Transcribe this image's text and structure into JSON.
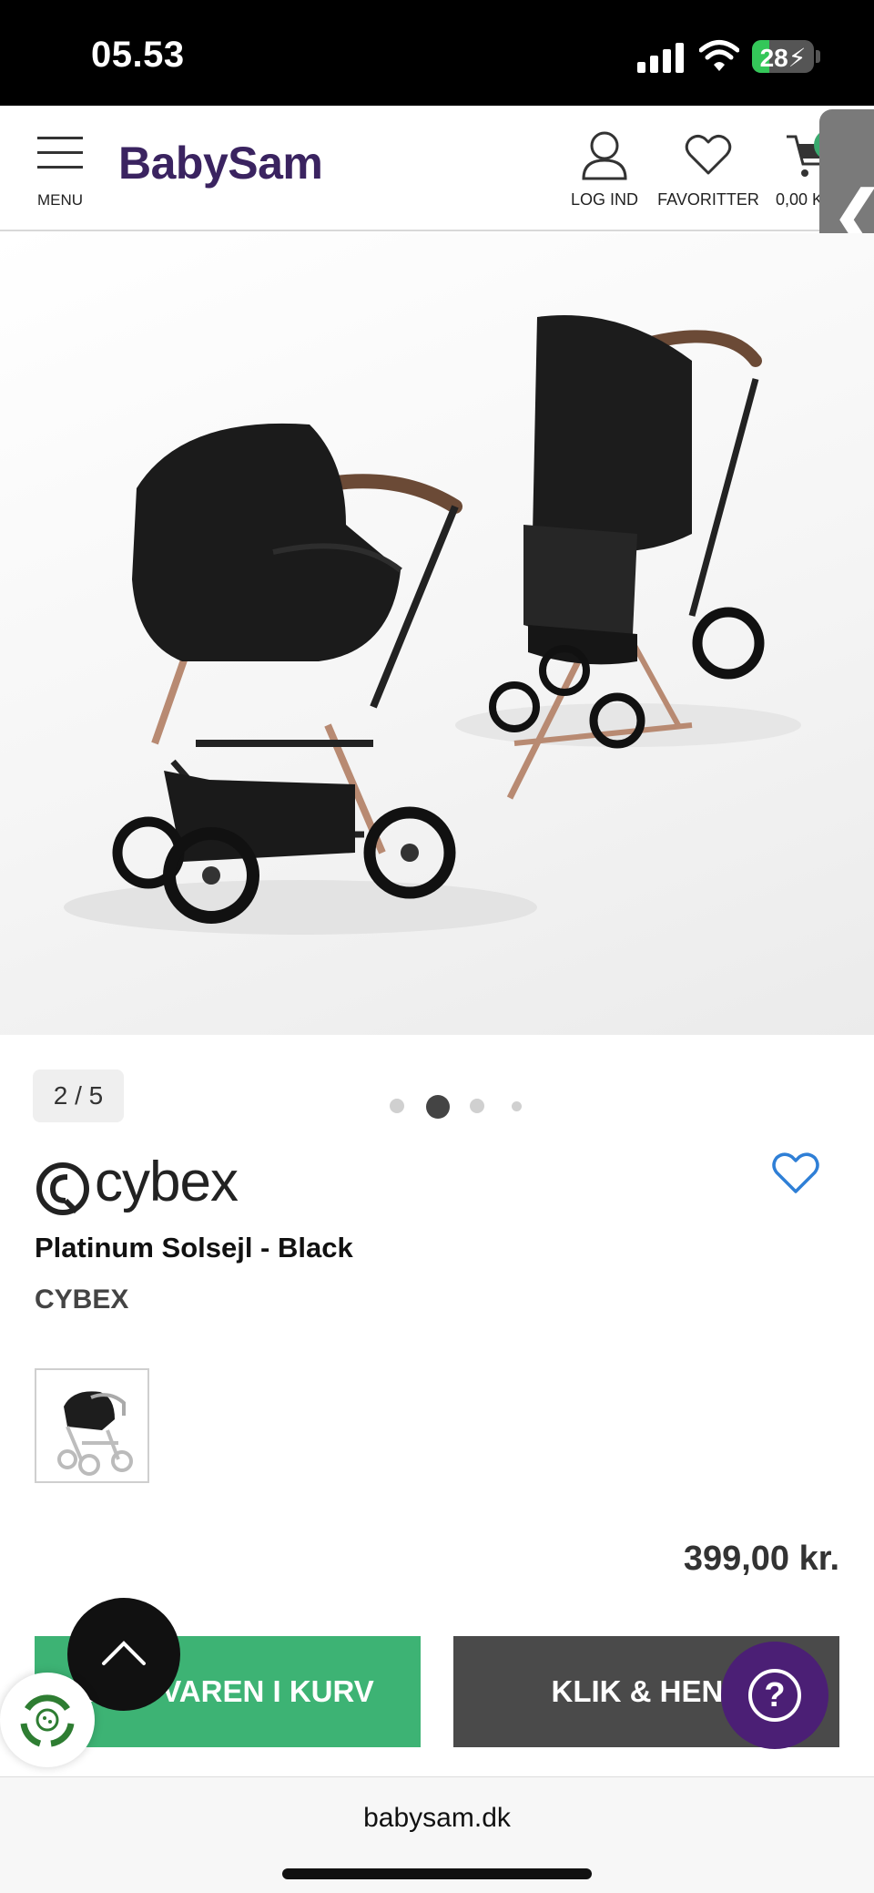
{
  "status_bar": {
    "time": "05.53",
    "battery": "28",
    "battery_level": 0.28,
    "icons": [
      "cellular-signal-icon",
      "wifi-icon",
      "battery-charging-icon"
    ]
  },
  "header": {
    "menu_label": "MENU",
    "logo": "BabySam",
    "login_label": "LOG IND",
    "favorites_label": "FAVORITTER",
    "cart_label": "0,00 K",
    "colors": {
      "logo": "#3a2360",
      "badge": "#3aaa6f"
    }
  },
  "gallery": {
    "counter": "2 / 5",
    "current_index": 2,
    "total": 5
  },
  "product": {
    "brand_logo_text": "cybex",
    "title": "Platinum Solsejl - Black",
    "brand": "CYBEX",
    "price": "399,00 kr."
  },
  "actions": {
    "add_to_cart": "LÆG VAREN I KURV",
    "click_collect": "KLIK & HENT",
    "help_symbol": "?",
    "colors": {
      "add": "#3db374",
      "click": "#4a4a4a",
      "help": "#4b1f75"
    }
  },
  "browser": {
    "url": "babysam.dk"
  }
}
